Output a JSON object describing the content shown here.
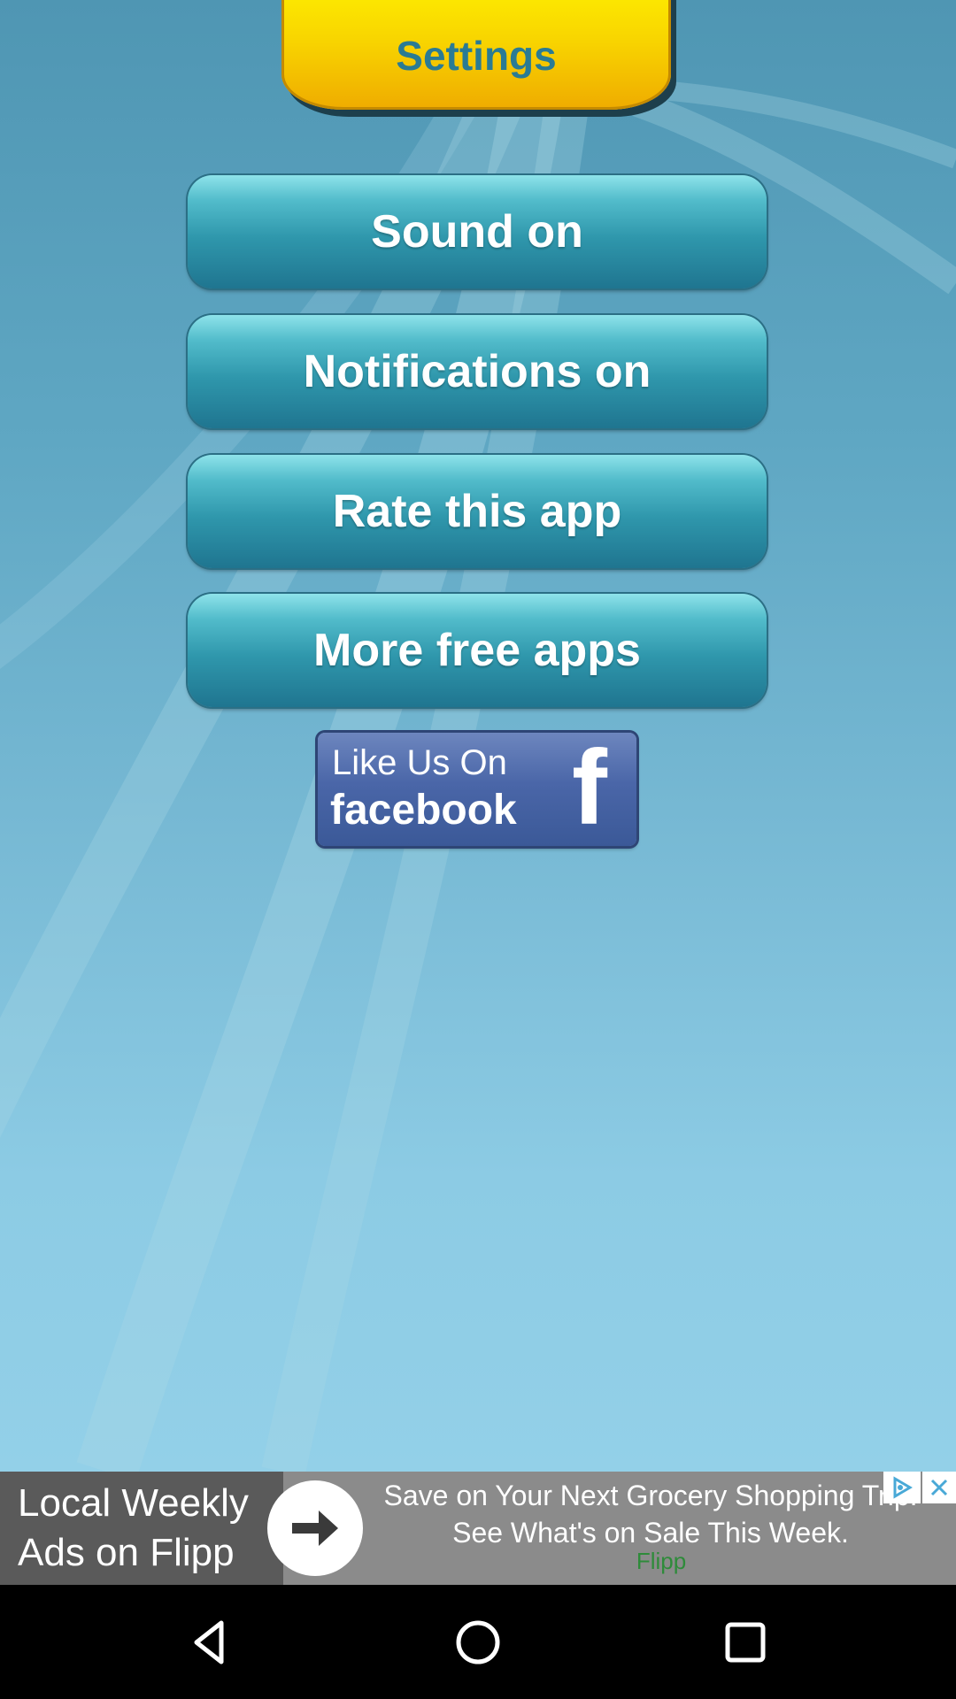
{
  "header": {
    "title": "Settings"
  },
  "menu": {
    "items": [
      {
        "label": "Sound on"
      },
      {
        "label": "Notifications on"
      },
      {
        "label": "Rate this app"
      },
      {
        "label": "More free apps"
      }
    ]
  },
  "facebook": {
    "line1": "Like Us On",
    "line2": "facebook",
    "logo_letter": "f"
  },
  "ad": {
    "headline": "Local Weekly Ads on Flipp",
    "body": "Save on Your Next Grocery Shopping Trip. See What's on Sale This Week.",
    "brand": "Flipp",
    "arrow_icon": "arrow-right-icon",
    "choices_icon": "ad-choices-icon",
    "close_icon": "close-icon"
  },
  "nav": {
    "back_icon": "back-triangle-icon",
    "home_icon": "home-circle-icon",
    "recents_icon": "recents-square-icon"
  },
  "colors": {
    "title": "#2a7b94",
    "tab_gold": "#f8d400",
    "button_teal": "#2f97ac",
    "facebook_blue": "#3b5998",
    "ad_brand": "#2e8b3a"
  }
}
